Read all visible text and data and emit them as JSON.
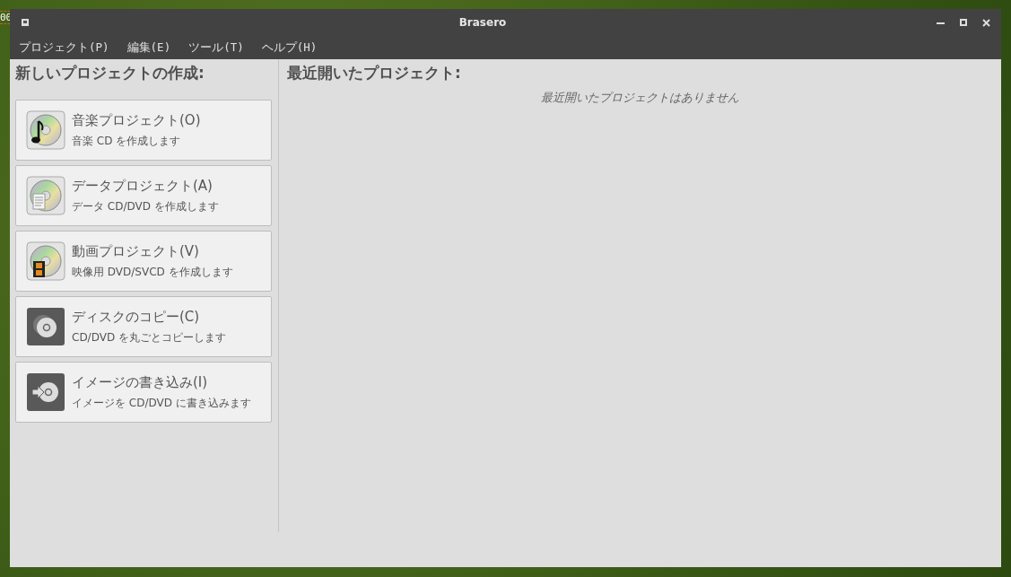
{
  "desktop": {
    "label": "00"
  },
  "window": {
    "title": "Brasero"
  },
  "menu": [
    "プロジェクト(P)",
    "編集(E)",
    "ツール(T)",
    "ヘルプ(H)"
  ],
  "new_project": {
    "heading": "新しいプロジェクトの作成:",
    "items": [
      {
        "kind": "music",
        "title": "音楽プロジェクト(O)",
        "description": "音楽 CD を作成します"
      },
      {
        "kind": "data",
        "title": "データプロジェクト(A)",
        "description": "データ CD/DVD を作成します"
      },
      {
        "kind": "video",
        "title": "動画プロジェクト(V)",
        "description": "映像用 DVD/SVCD を作成します"
      },
      {
        "kind": "copy",
        "title": "ディスクのコピー(C)",
        "description": "CD/DVD を丸ごとコピーします"
      },
      {
        "kind": "burn",
        "title": "イメージの書き込み(I)",
        "description": "イメージを CD/DVD に書き込みます"
      }
    ]
  },
  "recent": {
    "heading": "最近開いたプロジェクト:",
    "empty_message": "最近開いたプロジェクトはありません"
  }
}
